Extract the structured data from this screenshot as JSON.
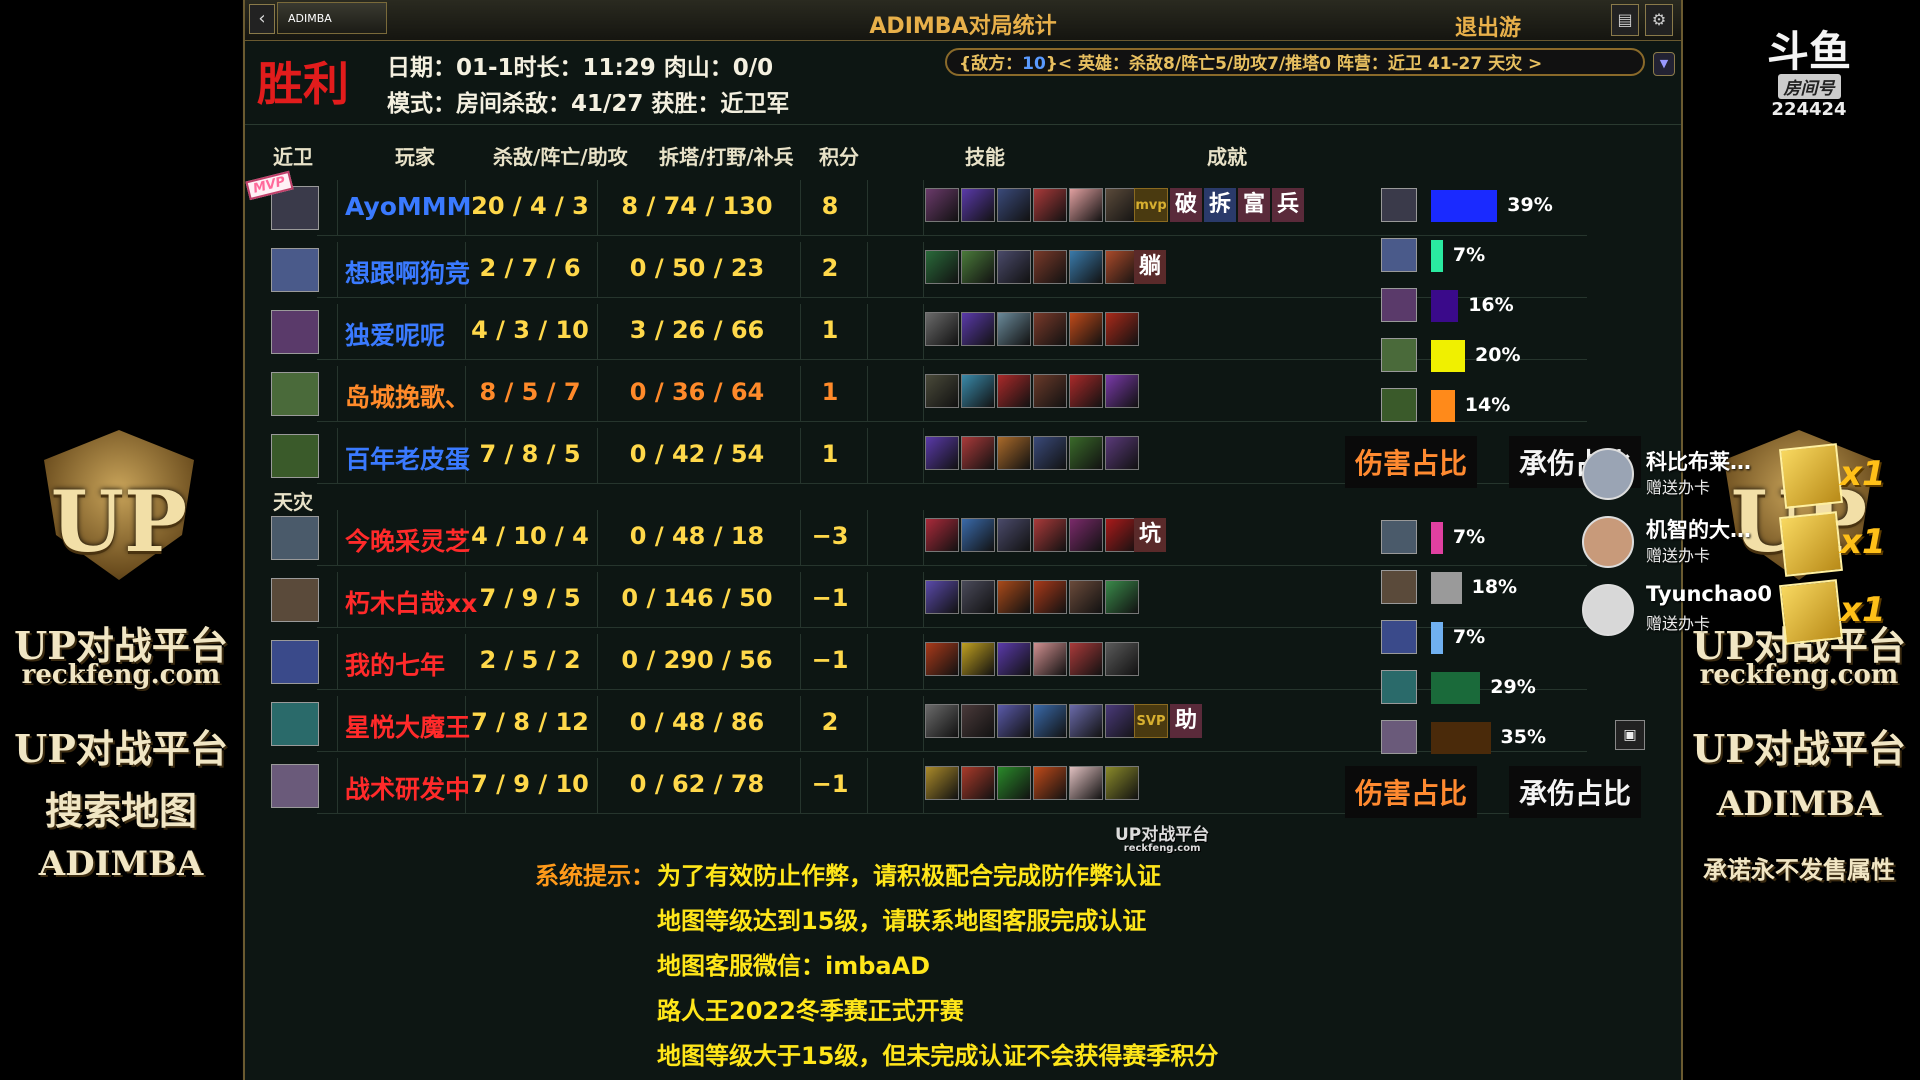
{
  "window": {
    "tab_label": "ADIMBA",
    "title": "ADIMBA对局统计",
    "exit_label": "退出游"
  },
  "header": {
    "result": "胜利",
    "line1": "日期：01-1时长：11:29  肉山：0/0",
    "line2": "模式：房间杀敌：41/27 获胜：近卫军",
    "summary_prefix": "{敌方：",
    "summary_num": "10",
    "summary_rest": "}< 英雄：杀敌8/阵亡5/助攻7/推塔0  阵营：近卫 41-27 天灾 >"
  },
  "columns": {
    "team1": "近卫",
    "player": "玩家",
    "kda": "杀敌/阵亡/助攻",
    "economy": "拆塔/打野/补兵",
    "score": "积分",
    "skills": "技能",
    "achievements": "成就"
  },
  "team2_label": "天灾",
  "sentinel": [
    {
      "name": "AyoMMM",
      "kda": "20 / 4 / 3",
      "eco": "8 / 74 / 130",
      "score": "8",
      "color": "#3a7aff",
      "mvp": "MVP",
      "achievements": [
        "mvp",
        "破",
        "拆",
        "富",
        "兵"
      ],
      "hero_color": "#3a3a4a",
      "skills": [
        "#6a3a6a",
        "#5a3aaa",
        "#3a4a7a",
        "#aa3a3a",
        "#e0a0a0",
        "#5a4a3a"
      ]
    },
    {
      "name": "想跟啊狗竞",
      "kda": "2 / 7 / 6",
      "eco": "0 / 50 / 23",
      "score": "2",
      "color": "#3a7aff",
      "achievements": [
        "躺"
      ],
      "hero_color": "#4a5a8a",
      "skills": [
        "#2a6a3a",
        "#4a7a3a",
        "#4a4a6a",
        "#7a3a2a",
        "#3a7aaa",
        "#aa4a2a"
      ]
    },
    {
      "name": "独爱呢呢",
      "kda": "4 / 3 / 10",
      "eco": "3 / 26 / 66",
      "score": "1",
      "color": "#3a7aff",
      "achievements": [],
      "hero_color": "#5a3a6a",
      "skills": [
        "#6a6a6a",
        "#5a3aaa",
        "#6a8a9a",
        "#7a3a2a",
        "#c04a1a",
        "#aa2a1a"
      ]
    },
    {
      "name": "岛城挽歌、",
      "kda": "8 / 5 / 7",
      "eco": "0 / 36 / 64",
      "score": "1",
      "color": "#ff8a2a",
      "achievements": [],
      "hero_color": "#4a6a3a",
      "skills": [
        "#4a4a3a",
        "#3a8aaa",
        "#aa2a2a",
        "#6a3a2a",
        "#aa2a2a",
        "#7a3aaa"
      ]
    },
    {
      "name": "百年老皮蛋",
      "kda": "7 / 8 / 5",
      "eco": "0 / 42 / 54",
      "score": "1",
      "color": "#3a7aff",
      "achievements": [],
      "hero_color": "#3a5a2a",
      "skills": [
        "#5a3aaa",
        "#aa3a3a",
        "#aa6a2a",
        "#3a4a7a",
        "#3a6a2a",
        "#5a3a7a"
      ]
    }
  ],
  "scourge": [
    {
      "name": "今晚采灵芝",
      "kda": "4 / 10 / 4",
      "eco": "0 / 48 / 18",
      "score": "−3",
      "color": "#ff2a2a",
      "achievements": [
        "坑"
      ],
      "hero_color": "#4a5a6a",
      "skills": [
        "#aa2a3a",
        "#3a6aaa",
        "#4a4a6a",
        "#aa3a3a",
        "#7a2a6a",
        "#aa1a1a"
      ]
    },
    {
      "name": "朽木白哉xx",
      "kda": "7 / 9 / 5",
      "eco": "0 / 146 / 50",
      "score": "−1",
      "color": "#ff2a2a",
      "achievements": [],
      "hero_color": "#5a4a3a",
      "skills": [
        "#5a4aaa",
        "#4a4a5a",
        "#aa4a1a",
        "#aa3a1a",
        "#6a4a3a",
        "#3a8a4a"
      ]
    },
    {
      "name": "我的七年",
      "kda": "2 / 5 / 2",
      "eco": "0 / 290 / 56",
      "score": "−1",
      "color": "#ff2a2a",
      "achievements": [],
      "hero_color": "#3a4a8a",
      "skills": [
        "#aa3a1a",
        "#c0a020",
        "#5a3aaa",
        "#d09090",
        "#aa3a3a",
        "#5a5a5a"
      ]
    },
    {
      "name": "星悦大魔王",
      "kda": "7 / 8 / 12",
      "eco": "0 / 48 / 86",
      "score": "2",
      "color": "#ff2a2a",
      "achievements": [
        "SVP",
        "助"
      ],
      "hero_color": "#2a6a6a",
      "skills": [
        "#6a6a6a",
        "#4a3a3a",
        "#5a5aaa",
        "#3a6aaa",
        "#6a6aaa",
        "#4a3a7a"
      ]
    },
    {
      "name": "战术研发中",
      "kda": "7 / 9 / 10",
      "eco": "0 / 62 / 78",
      "score": "−1",
      "color": "#ff2a2a",
      "achievements": [],
      "hero_color": "#6a5a7a",
      "skills": [
        "#aa8a2a",
        "#aa3a2a",
        "#2a8a2a",
        "#c04a1a",
        "#e0c0c0",
        "#8a8a2a"
      ]
    }
  ],
  "damage": {
    "sentinel": [
      {
        "pct": "39%",
        "value": 39,
        "color": "#1a2aff",
        "hero_color": "#3a3a4a"
      },
      {
        "pct": "7%",
        "value": 7,
        "color": "#2aeaa0",
        "hero_color": "#4a5a8a"
      },
      {
        "pct": "16%",
        "value": 16,
        "color": "#3a0a8a",
        "hero_color": "#5a3a6a"
      },
      {
        "pct": "20%",
        "value": 20,
        "color": "#f0f000",
        "hero_color": "#4a6a3a"
      },
      {
        "pct": "14%",
        "value": 14,
        "color": "#ff8a1a",
        "hero_color": "#3a5a2a"
      }
    ],
    "scourge": [
      {
        "pct": "7%",
        "value": 7,
        "color": "#e040a0",
        "hero_color": "#4a5a6a"
      },
      {
        "pct": "18%",
        "value": 18,
        "color": "#9a9a9a",
        "hero_color": "#5a4a3a"
      },
      {
        "pct": "7%",
        "value": 7,
        "color": "#70b0f0",
        "hero_color": "#3a4a8a"
      },
      {
        "pct": "29%",
        "value": 29,
        "color": "#1a6a3a",
        "hero_color": "#2a6a6a"
      },
      {
        "pct": "35%",
        "value": 35,
        "color": "#4a2a0a",
        "hero_color": "#6a5a7a"
      }
    ],
    "damage_label": "伤害占比",
    "taken_label": "承伤占比"
  },
  "watermark": {
    "line1": "UP对战平台",
    "line2": "reckfeng.com"
  },
  "tips": {
    "prefix": "系统提示：",
    "lines": [
      "为了有效防止作弊，请积极配合完成防作弊认证",
      "地图等级达到15级，请联系地图客服完成认证",
      "地图客服微信：imbaAD",
      "路人王2022冬季赛正式开赛",
      "地图等级大于15级，但未完成认证不会获得赛季积分"
    ]
  },
  "left_overlay": {
    "logo": "UP",
    "platform": "UP对战平台",
    "site": "reckfeng.com",
    "lines": [
      "UP对战平台",
      "搜索地图",
      "ADIMBA"
    ]
  },
  "right_overlay": {
    "logo": "UP",
    "platform": "UP对战平台",
    "site": "reckfeng.com",
    "lines": [
      "UP对战平台",
      "ADIMBA",
      "承诺永不发售属性"
    ]
  },
  "douyu": {
    "logo": "斗鱼",
    "tag": "房间号",
    "room": "224424"
  },
  "gifts": [
    {
      "user": "科比布莱…",
      "action": "赠送办卡",
      "count": "x1"
    },
    {
      "user": "机智的大…",
      "action": "赠送办卡",
      "count": "x1"
    },
    {
      "user": "Tyunchao0",
      "action": "赠送办卡",
      "count": "x1"
    }
  ]
}
